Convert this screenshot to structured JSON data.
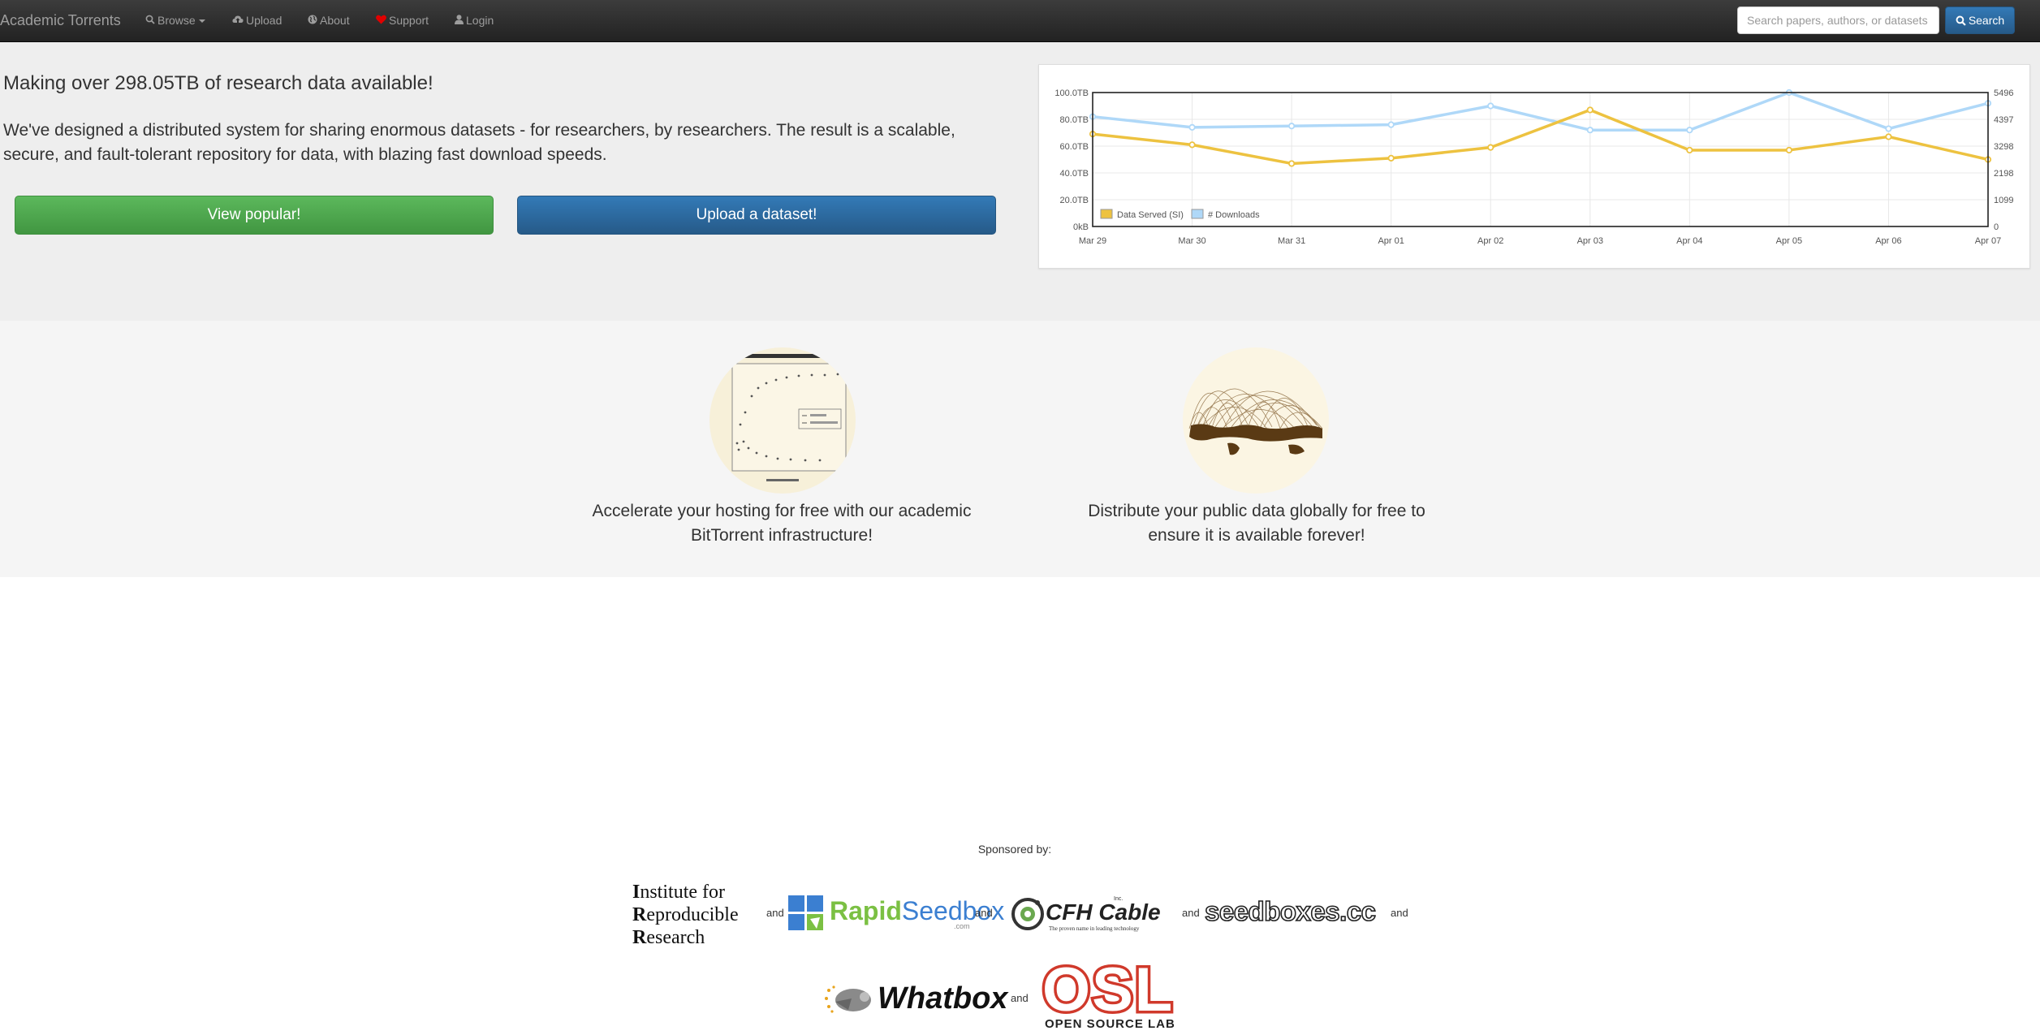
{
  "nav": {
    "brand": "Academic Torrents",
    "items": [
      {
        "label": "Browse",
        "icon": "search-icon"
      },
      {
        "label": "Upload",
        "icon": "cloud-upload-icon"
      },
      {
        "label": "About",
        "icon": "globe-icon"
      },
      {
        "label": "Support",
        "icon": "heart-icon"
      },
      {
        "label": "Login",
        "icon": "user-icon"
      }
    ],
    "search_placeholder": "Search papers, authors, or datasets",
    "search_button": "Search"
  },
  "hero": {
    "title": "Making over 298.05TB of research data available!",
    "description": "We've designed a distributed system for sharing enormous datasets - for researchers, by researchers. The result is a scalable, secure, and fault-tolerant repository for data, with blazing fast download speeds.",
    "btn_popular": "View popular!",
    "btn_upload": "Upload a dataset!"
  },
  "chart_data": {
    "type": "line",
    "categories": [
      "Mar 29",
      "Mar 30",
      "Mar 31",
      "Apr 01",
      "Apr 02",
      "Apr 03",
      "Apr 04",
      "Apr 05",
      "Apr 06",
      "Apr 07"
    ],
    "y_ticks_left": [
      "100.0TB",
      "80.0TB",
      "60.0TB",
      "40.0TB",
      "20.0TB",
      "0kB"
    ],
    "y_ticks_right": [
      "5496",
      "4397",
      "3298",
      "2198",
      "1099",
      "0"
    ],
    "ylim_left": [
      0,
      100
    ],
    "ylim_right": [
      0,
      5496
    ],
    "grid": true,
    "legend_position": "bottom-left",
    "colors": {
      "data_served": "#edc240",
      "downloads": "#afd8f8"
    },
    "series": [
      {
        "name": "Data Served (SI)",
        "axis": "left",
        "values": [
          69,
          61,
          47,
          51,
          59,
          87,
          57,
          57,
          67,
          50
        ]
      },
      {
        "name": "# Downloads",
        "axis": "right",
        "values": [
          4507,
          4067,
          4122,
          4177,
          4946,
          3957,
          3957,
          5496,
          4012,
          5056
        ]
      }
    ]
  },
  "features": [
    {
      "text_line1": "Accelerate your hosting for free with our academic",
      "text_line2": "BitTorrent infrastructure!",
      "image": "download-speed-chart-image"
    },
    {
      "text_line1": "Distribute your public data globally for free to",
      "text_line2": "ensure it is available forever!",
      "image": "global-network-map-image"
    }
  ],
  "sponsors": {
    "heading": "Sponsored by:",
    "and": "and",
    "irr": {
      "line1_cap": "I",
      "line1": "nstitute for",
      "line2_cap": "R",
      "line2": "eproducible",
      "line3_cap": "R",
      "line3": "esearch"
    },
    "rapidseedbox": {
      "name_a": "Rapid",
      "name_b": "Seedbox",
      "suffix": ".com"
    },
    "cfh": {
      "name": "CFH Cable",
      "tagline": "The proven name in leading technology",
      "inc": "Inc."
    },
    "seedboxes": {
      "name": "seedboxes.cc"
    },
    "whatbox": {
      "name": "Whatbox"
    },
    "osl": {
      "name": "OSL",
      "tagline": "OPEN SOURCE LAB"
    }
  }
}
